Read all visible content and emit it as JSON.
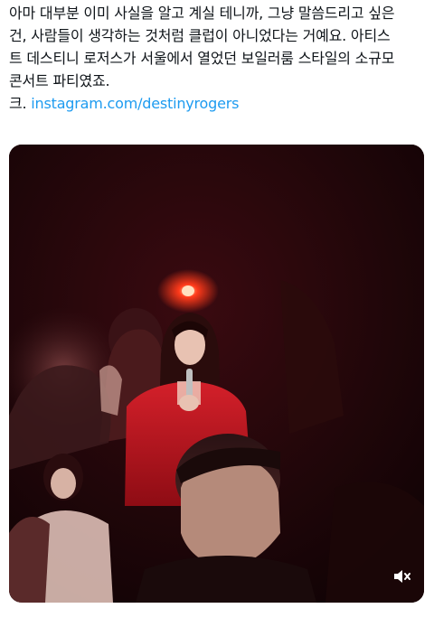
{
  "tweet": {
    "lines": [
      "아마 대부분 이미 사실을 알고 계실 테니까, 그냥 말씀드리고 싶은",
      "건, 사람들이 생각하는 것처럼 클럽이 아니었다는 거예요. 아티스",
      "트 데스티니 로저스가 서울에서 열었던 보일러룸 스타일의 소규모",
      "콘서트 파티였죠."
    ],
    "credit_prefix": "크.",
    "link_text": "instagram.com/destinyrogers"
  },
  "media": {
    "type": "video",
    "muted": true,
    "mute_icon": "speaker-muted-icon",
    "colors": {
      "background": "#1a0508",
      "stage_light": "#ff3a1a",
      "jacket_red": "#c4161c"
    }
  }
}
